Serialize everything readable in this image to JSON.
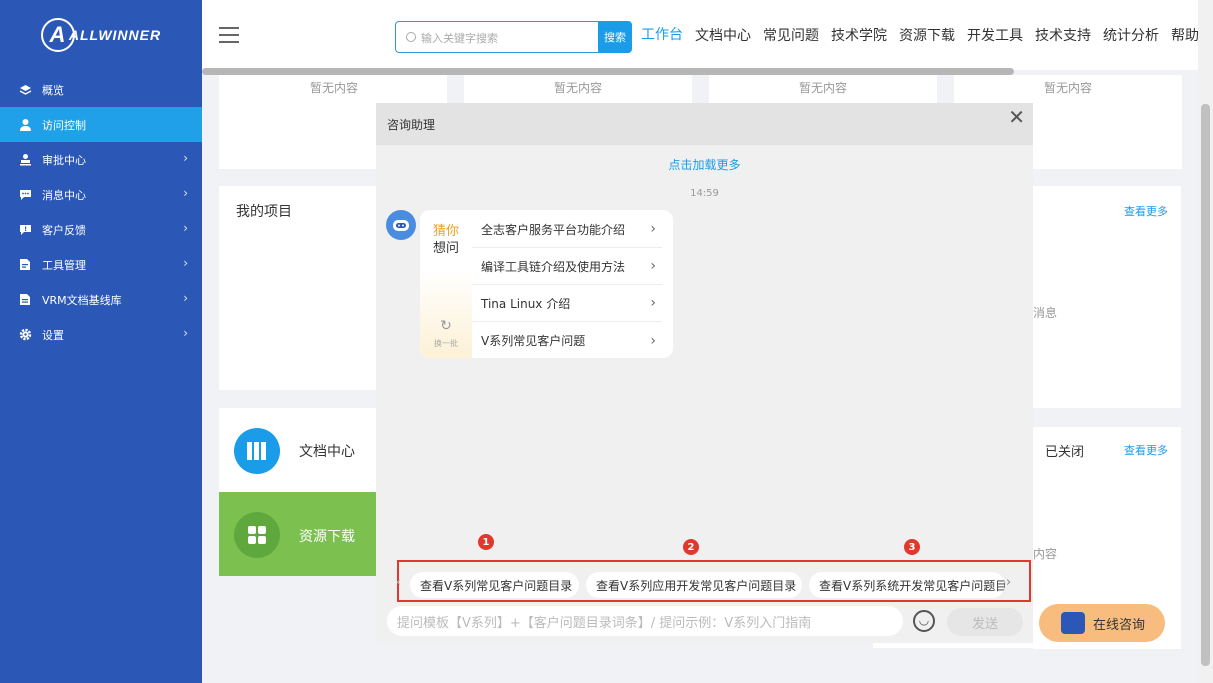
{
  "brand": {
    "logo_text": "ALLWINNER"
  },
  "sidebar": {
    "items": [
      {
        "label": "概览",
        "icon": "layers-icon"
      },
      {
        "label": "访问控制",
        "icon": "user-icon"
      },
      {
        "label": "审批中心",
        "icon": "approval-icon"
      },
      {
        "label": "消息中心",
        "icon": "message-icon"
      },
      {
        "label": "客户反馈",
        "icon": "feedback-icon"
      },
      {
        "label": "工具管理",
        "icon": "tool-icon"
      },
      {
        "label": "VRM文档基线库",
        "icon": "document-icon"
      },
      {
        "label": "设置",
        "icon": "gear-icon"
      }
    ]
  },
  "header": {
    "search_placeholder": "输入关键字搜索",
    "search_button": "搜索",
    "tabs": [
      "工作台",
      "文档中心",
      "常见问题",
      "技术学院",
      "资源下载",
      "开发工具",
      "技术支持",
      "统计分析",
      "帮助"
    ]
  },
  "dashboard": {
    "empty_text": "暂无内容",
    "my_projects": "我的项目",
    "view_more": "查看更多",
    "messages_partial": "消息",
    "closed_label": "已关闭",
    "content_partial": "内容",
    "doc_center": "文档中心",
    "resource_download": "资源下载"
  },
  "chat": {
    "title": "咨询助理",
    "load_more": "点击加载更多",
    "time": "14:59",
    "guess_line1": "猜你",
    "guess_line2": "想问",
    "refresh_label": "换一批",
    "questions": [
      "全志客户服务平台功能介绍",
      "编译工具链介绍及使用方法",
      "Tina Linux 介绍",
      "V系列常见客户问题"
    ],
    "suggestions": [
      "查看V系列常见客户问题目录",
      "查看V系列应用开发常见客户问题目录",
      "查看V系列系统开发常见客户问题目录"
    ],
    "badges": [
      "1",
      "2",
      "3"
    ],
    "input_placeholder": "提问模板【V系列】+【客户问题目录词条】/ 提问示例：V系列入门指南",
    "send": "发送",
    "online": "在线咨询"
  },
  "colors": {
    "sidebar": "#2b58b6",
    "accent": "#1a9ce8",
    "highlight": "#e0382c",
    "online_button": "#f8bd7e",
    "resource_card": "#7cc14f"
  }
}
